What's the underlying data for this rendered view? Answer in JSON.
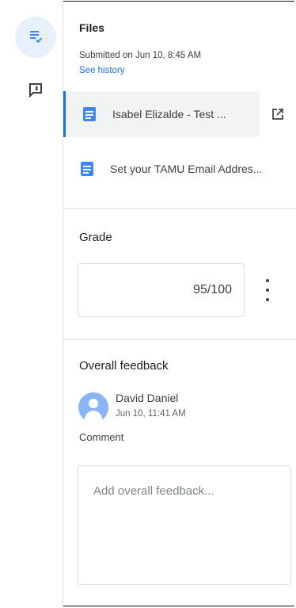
{
  "files": {
    "title": "Files",
    "submitted": "Submitted on Jun 10, 8:45 AM",
    "history_link": "See history",
    "items": [
      {
        "name": "Isabel Elizalde - Test ..."
      },
      {
        "name": "Set your TAMU Email Addres..."
      }
    ]
  },
  "grade": {
    "title": "Grade",
    "value": "95/100"
  },
  "feedback": {
    "title": "Overall feedback",
    "author": "David Daniel",
    "time": "Jun 10, 11:41 AM",
    "comment_label": "Comment",
    "placeholder": "Add overall feedback..."
  },
  "icons": {
    "rail_active": "assignment-list-icon",
    "rail_comments": "comment-icon",
    "doc": "document-icon",
    "open": "open-in-new-icon",
    "more": "more-vert-icon"
  }
}
